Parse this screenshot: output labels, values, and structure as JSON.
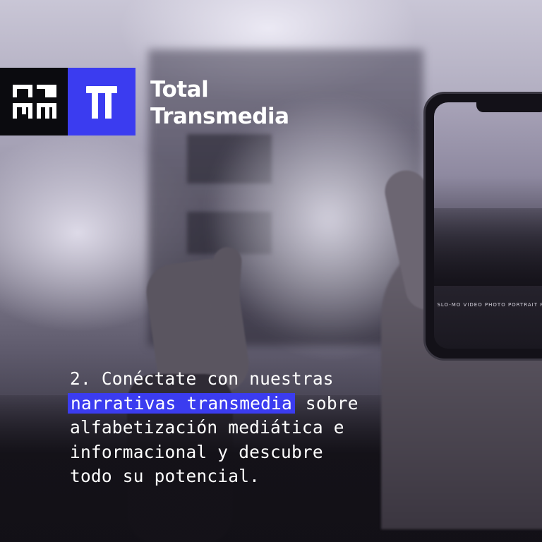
{
  "brand": {
    "line1": "Total",
    "line2": "Transmedia",
    "logo_left": "DIM-pixel-logo",
    "logo_right": "pi-icon",
    "accent": "#3b3cf0"
  },
  "phone": {
    "camera_modes": "SLO-MO   VIDEO   PHOTO   PORTRAIT   PANO"
  },
  "caption": {
    "line1": "2. Conéctate con nuestras",
    "highlight": "narrativas transmedia",
    "line2_rest": " sobre",
    "line3": "alfabetización mediática e",
    "line4": "informacional y descubre",
    "line5": "todo su potencial."
  }
}
